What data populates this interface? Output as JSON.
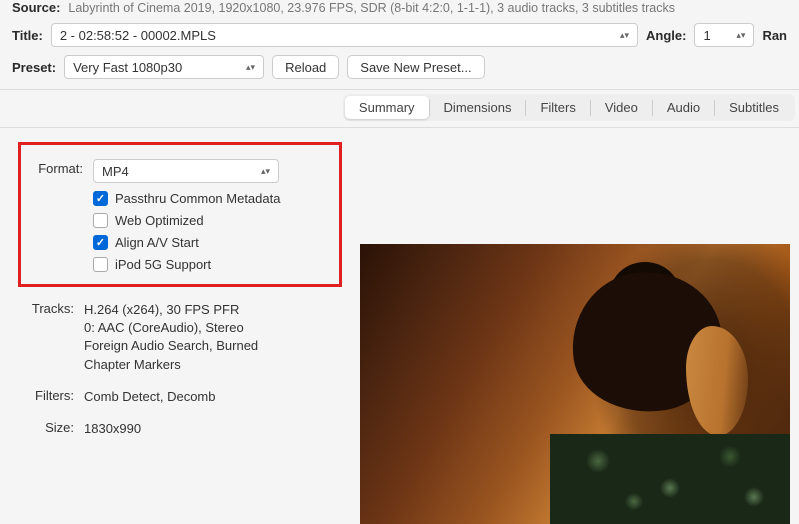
{
  "source": {
    "label": "Source:",
    "text": "Labyrinth of Cinema 2019, 1920x1080, 23.976 FPS, SDR (8-bit 4:2:0, 1-1-1), 3 audio tracks, 3 subtitles tracks"
  },
  "title": {
    "label": "Title:",
    "value": "2 - 02:58:52 - 00002.MPLS"
  },
  "angle": {
    "label": "Angle:",
    "value": "1"
  },
  "range": {
    "label": "Ran"
  },
  "preset": {
    "label": "Preset:",
    "value": "Very Fast 1080p30",
    "reload": "Reload",
    "savenew": "Save New Preset..."
  },
  "tabs": {
    "summary": "Summary",
    "dimensions": "Dimensions",
    "filters": "Filters",
    "video": "Video",
    "audio": "Audio",
    "subtitles": "Subtitles"
  },
  "format": {
    "label": "Format:",
    "value": "MP4",
    "passthru": "Passthru Common Metadata",
    "webopt": "Web Optimized",
    "alignav": "Align A/V Start",
    "ipod": "iPod 5G Support"
  },
  "tracks": {
    "label": "Tracks:",
    "line1": "H.264 (x264), 30 FPS PFR",
    "line2": "0: AAC (CoreAudio), Stereo",
    "line3": "Foreign Audio Search, Burned",
    "line4": "Chapter Markers"
  },
  "filters": {
    "label": "Filters:",
    "value": "Comb Detect, Decomb"
  },
  "size": {
    "label": "Size:",
    "value": "1830x990"
  }
}
